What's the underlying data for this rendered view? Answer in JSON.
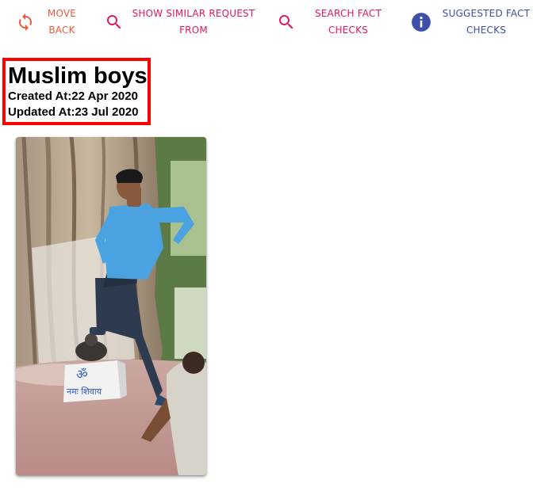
{
  "toolbar": {
    "move_back": {
      "label": "MOVE BACK",
      "icon": "refresh-icon",
      "color": "#ee5a3a"
    },
    "similar": {
      "label": "SHOW SIMILAR REQUEST FROM",
      "icon": "search-icon",
      "color": "#e2185c"
    },
    "search_fact": {
      "label": "SEARCH FACT CHECKS",
      "icon": "search-icon",
      "color": "#e2185c"
    },
    "suggested": {
      "label": "SUGGESTED FACT CHECKS",
      "icon": "info-icon",
      "color": "#3d4fa8"
    }
  },
  "item": {
    "title": "Muslim boys",
    "created": "Created At:22 Apr 2020",
    "updated": "Updated At:23 Jul 2020",
    "highlight_color": "#ff0000"
  },
  "photo": {
    "inscription": "नमः शिवाय"
  }
}
